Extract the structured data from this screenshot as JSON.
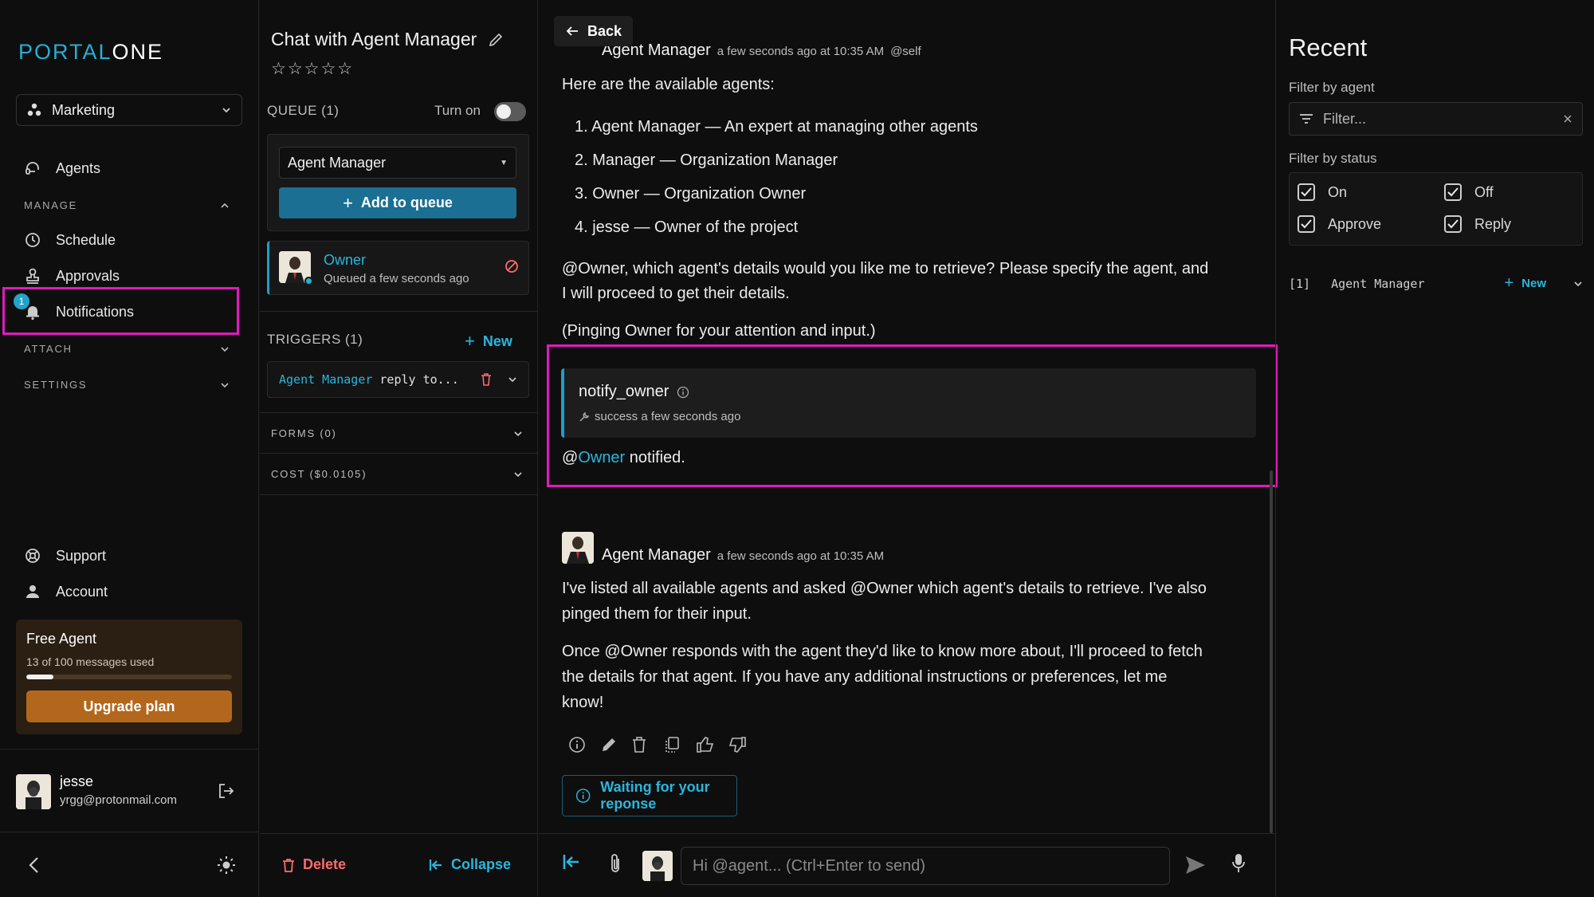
{
  "sidebar": {
    "logo_part1": "PORTAL",
    "logo_part2": "ONE",
    "team": "Marketing",
    "nav": {
      "agents": "Agents",
      "schedule": "Schedule",
      "approvals": "Approvals",
      "notifications": "Notifications",
      "notifications_badge": "1",
      "support": "Support",
      "account": "Account"
    },
    "sections": {
      "manage": "MANAGE",
      "attach": "ATTACH",
      "settings": "SETTINGS"
    },
    "plan": {
      "title": "Free Agent",
      "usage": "13 of 100 messages used",
      "usage_fraction": 0.13,
      "upgrade_label": "Upgrade plan"
    },
    "user": {
      "name": "jesse",
      "email": "yrgg@protonmail.com"
    }
  },
  "middle": {
    "title": "Chat with Agent Manager",
    "rating_stars": "☆☆☆☆☆",
    "queue_header": "QUEUE (1)",
    "turn_on_label": "Turn on",
    "toggle_on": false,
    "agent_select": "Agent Manager",
    "add_to_queue": "Add to queue",
    "queued": {
      "name": "Owner",
      "status": "Queued a few seconds ago"
    },
    "triggers_header": "TRIGGERS (1)",
    "triggers_new": "New",
    "trigger": {
      "agent": "Agent Manager",
      "text": "reply to..."
    },
    "forms_header": "FORMS (0)",
    "cost_header": "COST ($0.0105)",
    "delete_label": "Delete",
    "collapse_label": "Collapse"
  },
  "chat": {
    "back_label": "Back",
    "msg1": {
      "author": "Agent Manager",
      "meta": "a few seconds ago at 10:35 AM",
      "self_tag": "@self",
      "intro": "Here are the available agents:",
      "list": [
        "1. Agent Manager — An expert at managing other agents",
        "2. Manager — Organization Manager",
        "3. Owner — Organization Owner",
        "4. jesse — Owner of the project"
      ],
      "question_line1": "@Owner, which agent's details would you like me to retrieve? Please specify the agent, and",
      "question_line2": "I will proceed to get their details.",
      "ping": "(Pinging Owner for your attention and input.)",
      "tool_name": "notify_owner",
      "tool_status": "success a few seconds ago",
      "notified_at": "@",
      "notified_mention": "Owner",
      "notified_rest": " notified."
    },
    "msg2": {
      "author": "Agent Manager",
      "meta": "a few seconds ago at 10:35 AM",
      "p1_line1": "I've listed all available agents and asked @Owner which agent's details to retrieve. I've also",
      "p1_line2": "pinged them for their input.",
      "p2_line1": "Once @Owner responds with the agent they'd like to know more about, I'll proceed to fetch",
      "p2_line2": "the details for that agent. If you have any additional instructions or preferences, let me",
      "p2_line3": "know!"
    },
    "waiting_label": "Waiting for your reponse",
    "input_placeholder": "Hi @agent... (Ctrl+Enter to send)"
  },
  "recent": {
    "title": "Recent",
    "filter_agent_label": "Filter by agent",
    "filter_placeholder": "Filter...",
    "filter_status_label": "Filter by status",
    "statuses": [
      "On",
      "Off",
      "Approve",
      "Reply"
    ],
    "item": {
      "index": "[1]",
      "agent": "Agent Manager",
      "new_label": "New"
    }
  },
  "colors": {
    "accent": "#2bb6dd",
    "highlight": "#e01bbd",
    "danger": "#ff6b6b",
    "upgrade": "#b3671c"
  }
}
